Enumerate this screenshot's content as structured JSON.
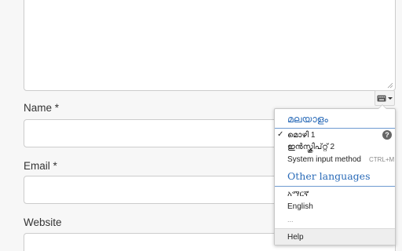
{
  "form": {
    "name_label": "Name *",
    "email_label": "Email *",
    "website_label": "Website"
  },
  "ime": {
    "trigger_icon": "keyboard-icon",
    "menu": {
      "language_heading": "മലയാളം",
      "input_methods": [
        {
          "label": "മൊഴി 1",
          "selected": true,
          "has_help": true,
          "help_symbol": "?"
        },
        {
          "label": "ഇൻസ്ക്രിപ്റ്റ് 2",
          "selected": false
        },
        {
          "label": "System input method",
          "shortcut": "CTRL+M",
          "selected": false
        }
      ],
      "check_symbol": "✓",
      "other_languages_heading": "Other languages",
      "languages": [
        "አማርኛ",
        "English"
      ],
      "more_label": "...",
      "help_label": "Help"
    }
  },
  "colors": {
    "heading_blue": "#2a6bb8",
    "background": "#f7f7f7"
  }
}
